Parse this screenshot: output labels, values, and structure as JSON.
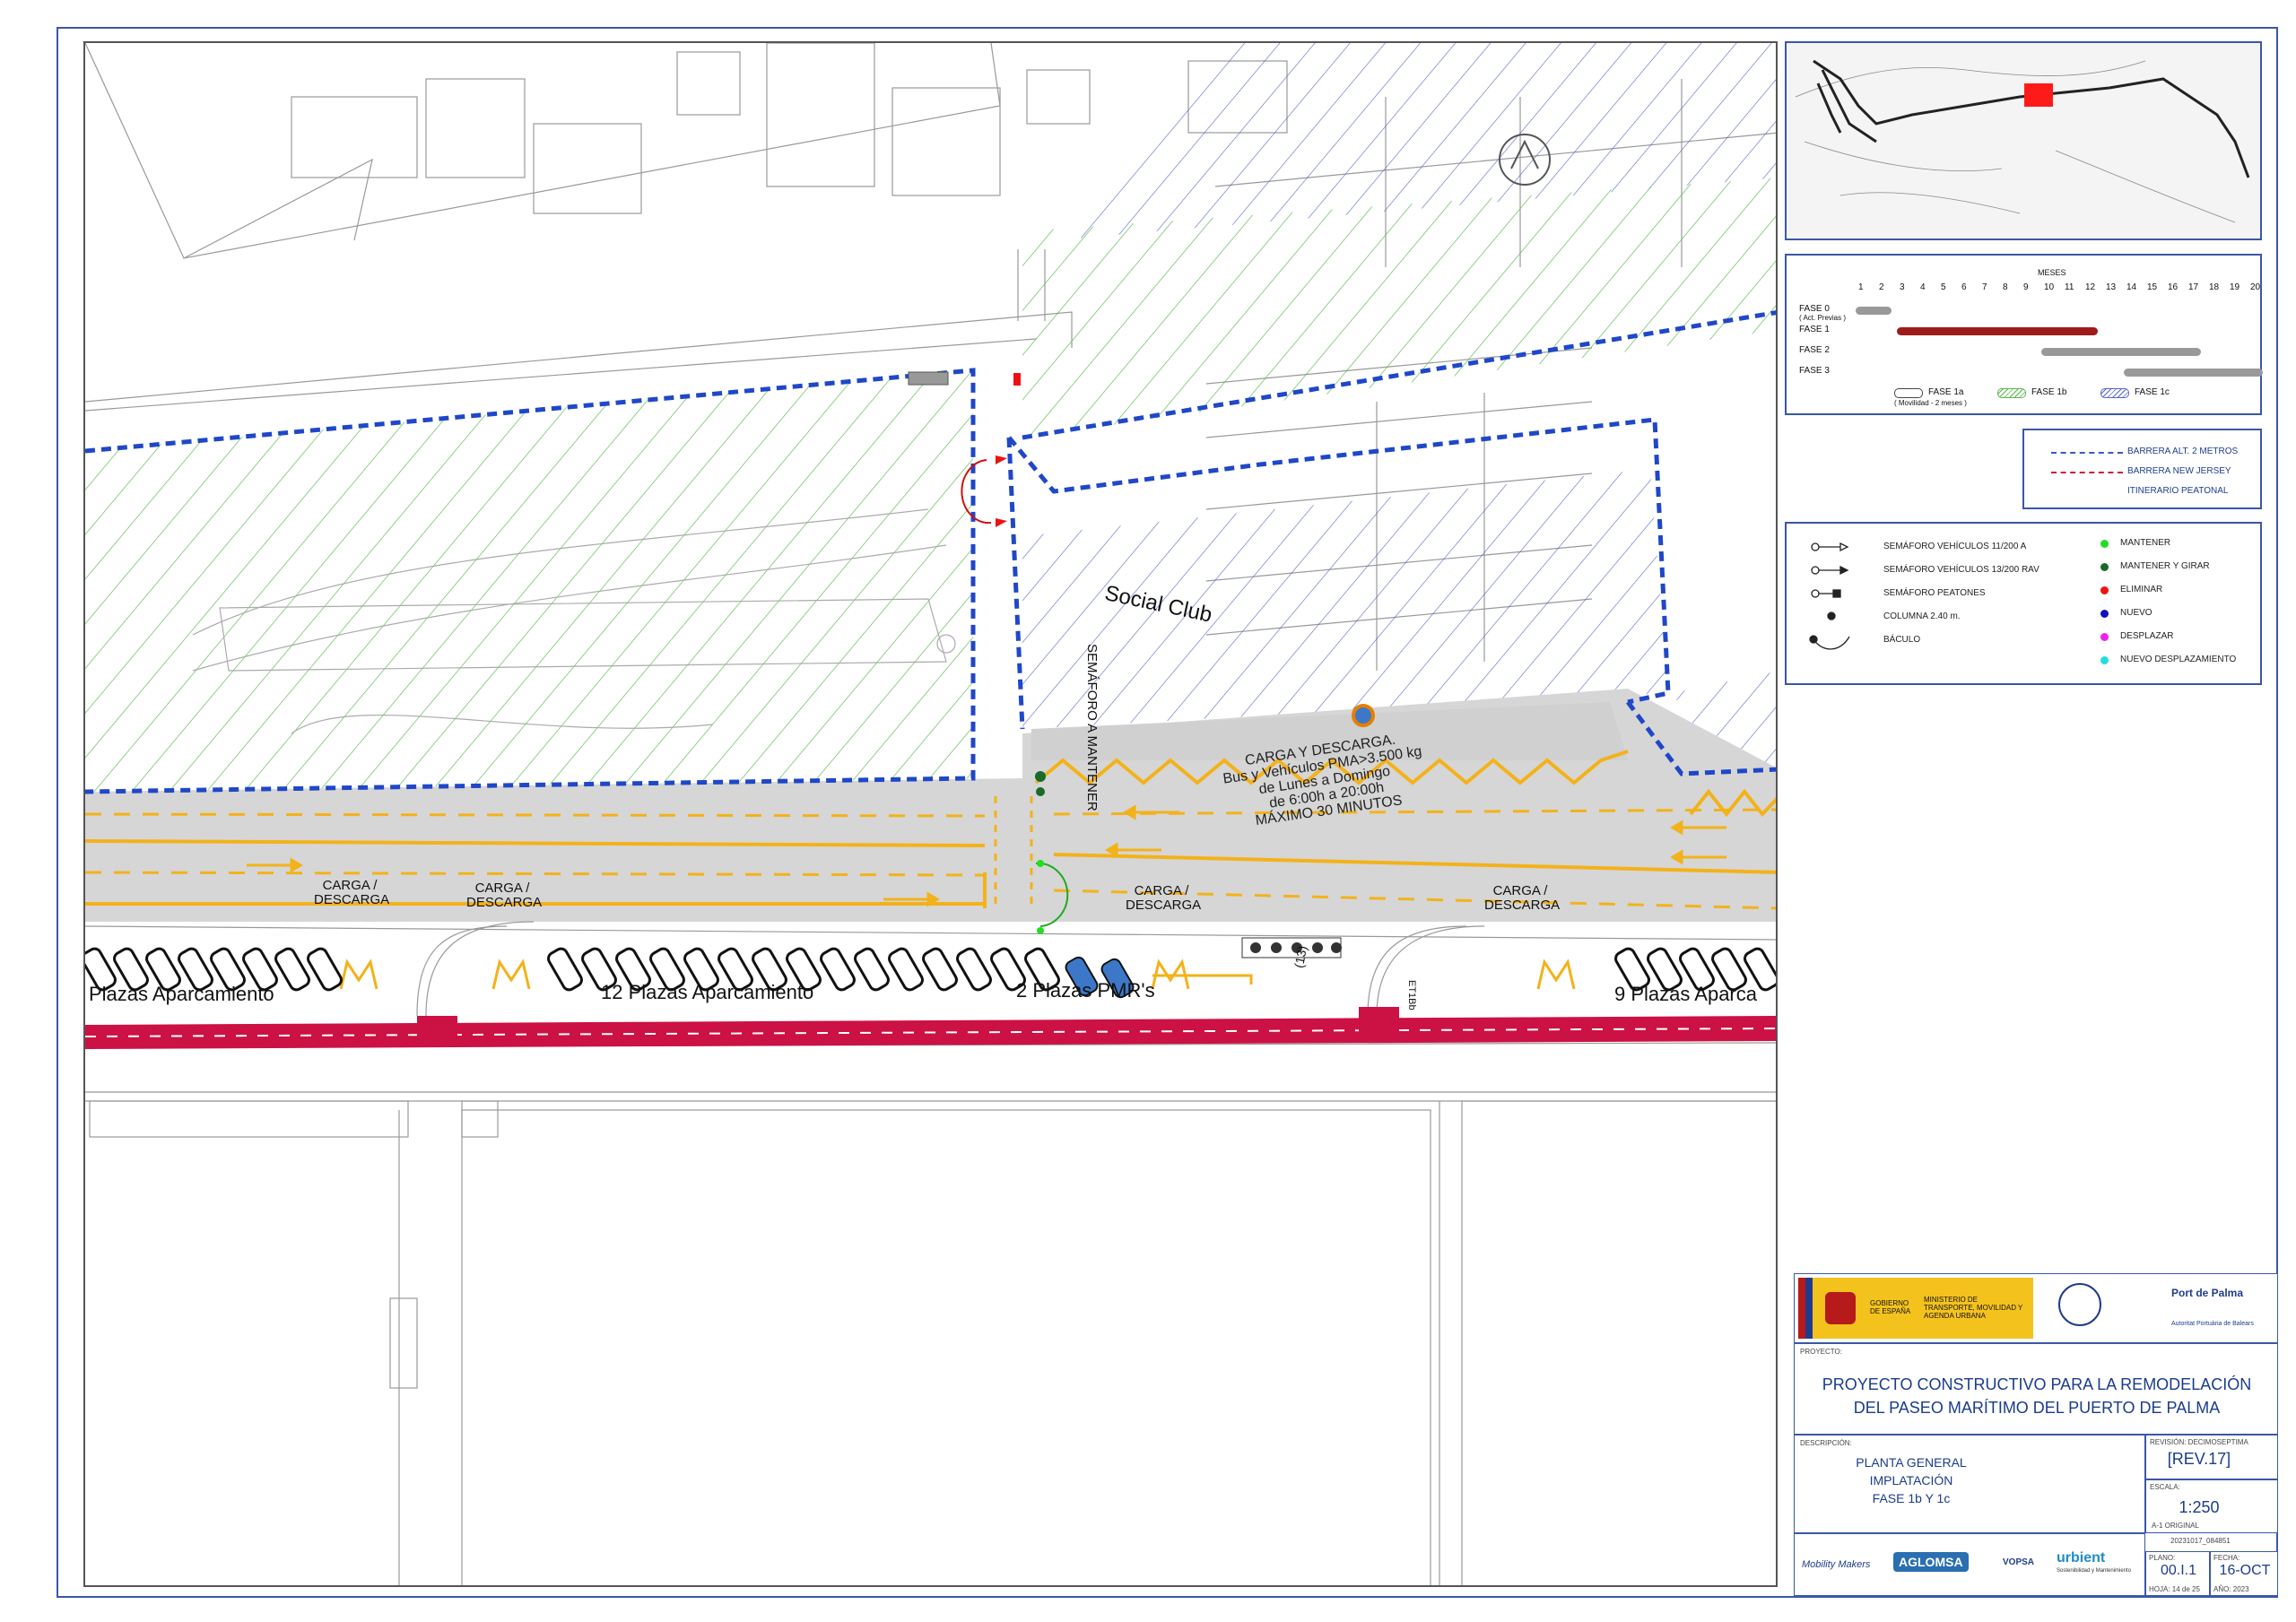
{
  "map": {
    "labels": {
      "social_club": "Social Club",
      "semaforo": "SEMÁFORO A MANTENER",
      "carga_title": "CARGA Y DESCARGA.",
      "carga_line1": "Bus y Vehículos PMA>3.500 kg",
      "carga_line2": "de Lunes a Domingo",
      "carga_line3": "de 6:00h a 20:00h",
      "carga_line4": "MÁXIMO 30 MINUTOS",
      "cd_a": "CARGA / DESCARGA",
      "cd_b": "CARGA / DESCARGA",
      "cd_c": "CARGA / DESCARGA",
      "cd_d": "CARGA / DESCARGA",
      "plazas_1": "Plazas Aparcamiento",
      "plazas_2": "12 Plazas Aparcamiento",
      "plazas_3": "2 Plazas PMR's",
      "plazas_4": "9 Plazas Aparca",
      "tree_count": "(13)",
      "et_label": "ET1Bb"
    },
    "colors": {
      "blue_barrier": "#1f47c8",
      "green_hatch": "#56b848",
      "blue_hatch": "#5566cc",
      "red_path": "#cc1144",
      "yellow_mark": "#f3b21a",
      "road": "#d6d6d6"
    }
  },
  "keymap": {
    "highlight_color": "#ff1a1a"
  },
  "gantt": {
    "title": "MESES",
    "months": [
      "1",
      "2",
      "3",
      "4",
      "5",
      "6",
      "7",
      "8",
      "9",
      "10",
      "11",
      "12",
      "13",
      "14",
      "15",
      "16",
      "17",
      "18",
      "19",
      "20"
    ],
    "phases": [
      {
        "label": "FASE 0",
        "sub": "( Act. Previas )",
        "start": 1,
        "end": 2,
        "color": "#999999"
      },
      {
        "label": "FASE 1",
        "sub": "",
        "start": 3,
        "end": 12,
        "color": "#9e1b1b"
      },
      {
        "label": "FASE 2",
        "sub": "",
        "start": 10,
        "end": 17,
        "color": "#999999"
      },
      {
        "label": "FASE 3",
        "sub": "",
        "start": 14,
        "end": 20,
        "color": "#999999"
      }
    ],
    "legend": [
      {
        "label": "FASE 1a",
        "sub": "( Movilidad - 2 meses )"
      },
      {
        "label": "FASE 1b",
        "sub": ""
      },
      {
        "label": "FASE 1c",
        "sub": ""
      }
    ]
  },
  "barrier_legend": [
    {
      "label": "BARRERA ALT. 2 METROS",
      "color": "#3a57c8"
    },
    {
      "label": "BARRERA NEW JERSEY",
      "color": "#cc2233"
    },
    {
      "label": "ITINERARIO  PEATONAL",
      "color": ""
    }
  ],
  "symbol_legend": {
    "left": [
      "SEMÁFORO VEHÍCULOS 11/200 A",
      "SEMÁFORO VEHÍCULOS 13/200 RAV",
      "SEMÁFORO PEATONES",
      "COLUMNA 2.40 m.",
      "BÁCULO"
    ],
    "right": [
      {
        "label": "MANTENER",
        "color": "#22dd22"
      },
      {
        "label": "MANTENER Y GIRAR",
        "color": "#1a6a2a"
      },
      {
        "label": "ELIMINAR",
        "color": "#ee1111"
      },
      {
        "label": "NUEVO",
        "color": "#1111bb"
      },
      {
        "label": "DESPLAZAR",
        "color": "#ee22ee"
      },
      {
        "label": "NUEVO DESPLAZAMIENTO",
        "color": "#22dddd"
      }
    ]
  },
  "titleblock": {
    "gov_1": "GOBIERNO DE ESPAÑA",
    "gov_2": "MINISTERIO DE TRANSPORTE, MOVILIDAD Y AGENDA URBANA",
    "port": "Port de Palma",
    "port_sub": "Autoritat Portuària de Balears",
    "proyecto_label": "PROYECTO:",
    "proyecto_1": "PROYECTO CONSTRUCTIVO PARA LA REMODELACIÓN",
    "proyecto_2": "DEL PASEO MARÍTIMO DEL PUERTO DE PALMA",
    "descripcion_label": "DESCRIPCIÓN:",
    "desc_1": "PLANTA GENERAL",
    "desc_2": "IMPLATACIÓN",
    "desc_3": "FASE 1b Y 1c",
    "revision_label": "REVISIÓN: DECIMOSEPTIMA",
    "revision": "[REV.17]",
    "escala_label": "ESCALA:",
    "escala": "1:250",
    "escala_sub": "A-1 ORIGINAL",
    "code": "20231017_084851",
    "plano_label": "PLANO:",
    "plano": "00.I.1",
    "hoja": "HOJA: 14 de 25",
    "fecha_label": "FECHA:",
    "fecha": "16-OCT",
    "ano": "AÑO: 2023",
    "firms": [
      "Mobility Makers",
      "AGLOMSA",
      "VOPSA",
      "urbient"
    ],
    "urbient_sub": "Sostenibilidad y Mantenimiento"
  }
}
